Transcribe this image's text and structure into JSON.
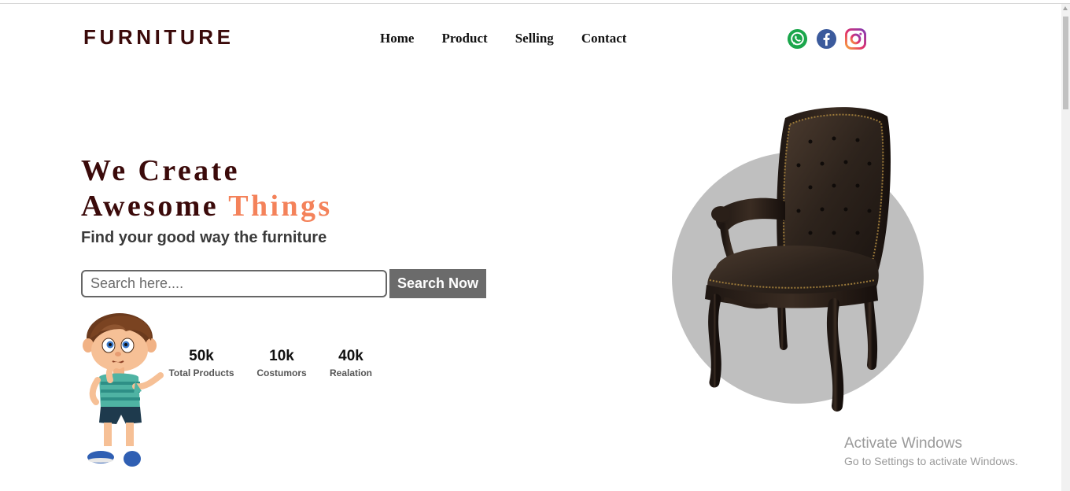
{
  "brand": {
    "logo": "FURNITURE"
  },
  "nav": {
    "items": [
      {
        "label": "Home"
      },
      {
        "label": "Product"
      },
      {
        "label": "Selling"
      },
      {
        "label": "Contact"
      }
    ]
  },
  "socials": {
    "icons": [
      "whatsapp-icon",
      "facebook-icon",
      "instagram-icon"
    ]
  },
  "hero": {
    "title_line1": "We Create",
    "title_line2_main": "Awesome",
    "title_line2_accent": "Things",
    "subtitle": "Find your good way the furniture",
    "search_placeholder": "Search here....",
    "search_value": "",
    "search_button": "Search Now"
  },
  "stats": [
    {
      "value": "50k",
      "label": "Total Products"
    },
    {
      "value": "10k",
      "label": "Costumors"
    },
    {
      "value": "40k",
      "label": "Realation"
    }
  ],
  "watermark": {
    "title": "Activate Windows",
    "subtitle": "Go to Settings to activate Windows."
  },
  "colors": {
    "brand_dark": "#3b0a0a",
    "accent": "#f4825a",
    "button": "#6b6b6b",
    "circle": "#bfbfbf"
  }
}
